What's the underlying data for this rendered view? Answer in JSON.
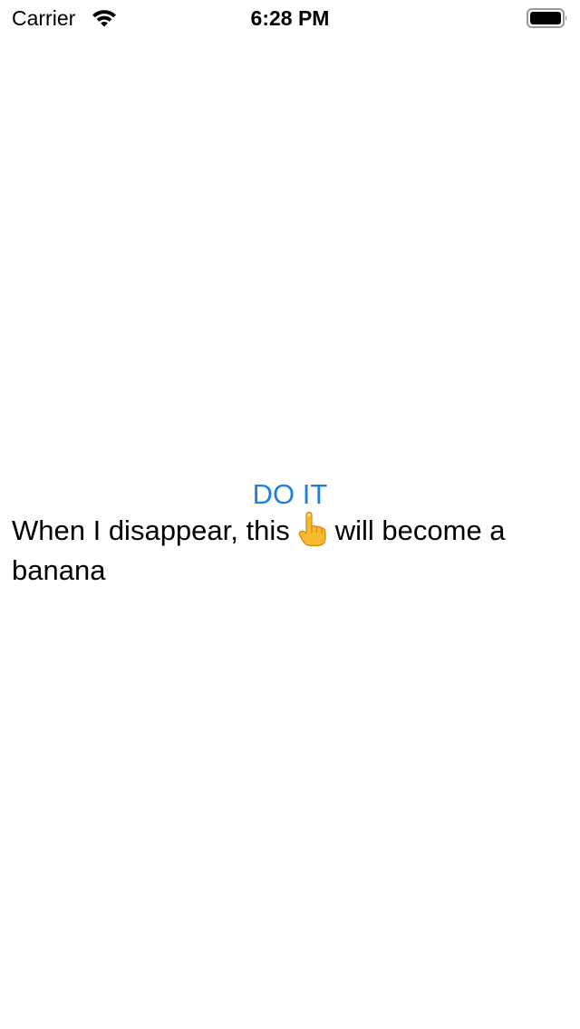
{
  "status_bar": {
    "carrier": "Carrier",
    "time": "6:28 PM",
    "wifi_icon": "wifi-icon",
    "battery_icon": "battery-icon"
  },
  "main": {
    "button_label": "DO IT",
    "message_before": "When I disappear, this",
    "message_icon": "pointing-up-hand-icon",
    "message_after": "will become a banana"
  },
  "colors": {
    "accent": "#1f7fe0",
    "text": "#000000",
    "background": "#ffffff"
  }
}
